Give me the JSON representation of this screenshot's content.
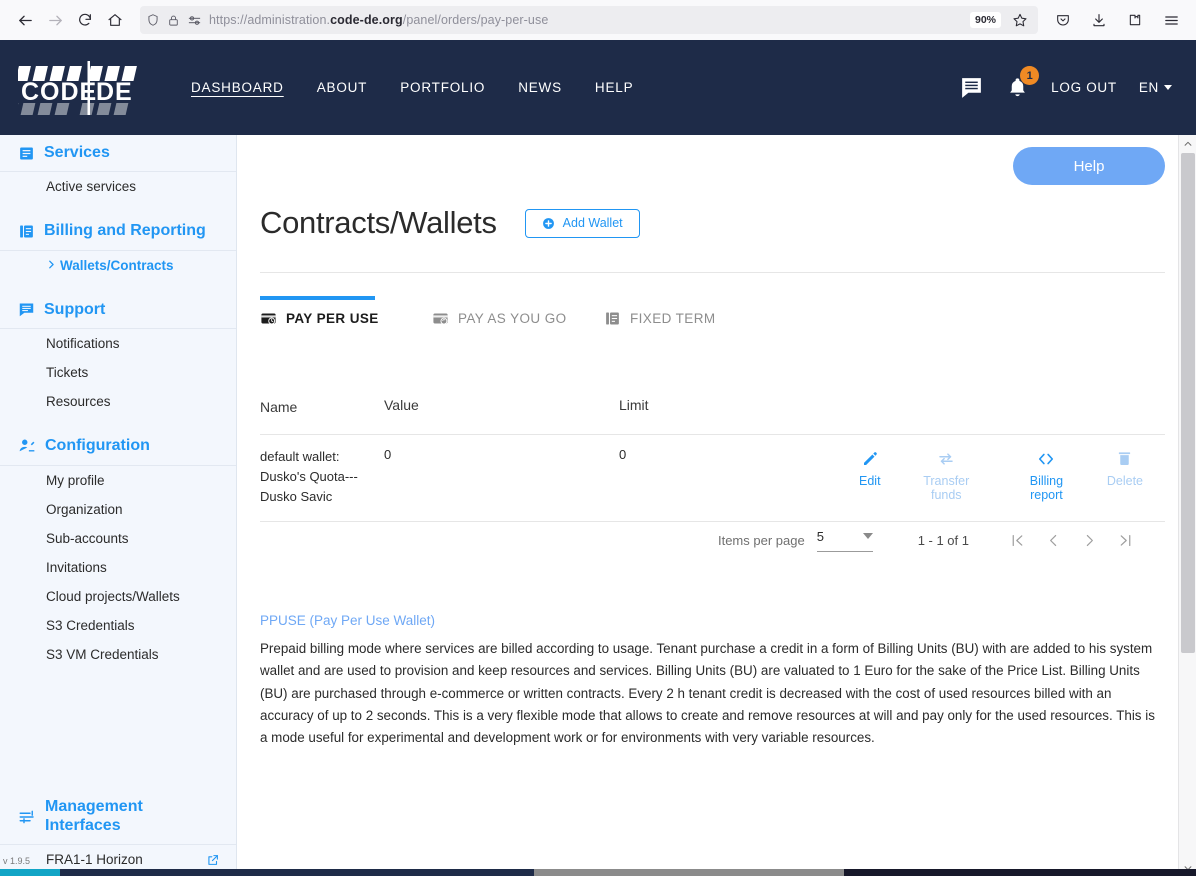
{
  "browser": {
    "back_icon": "back-arrow-icon",
    "forward_icon": "forward-arrow-icon",
    "reload_icon": "reload-icon",
    "home_icon": "home-icon",
    "shield_icon": "shield-icon",
    "lock_icon": "padlock-icon",
    "permissions_icon": "permissions-icon",
    "url_prefix": "https://administration.",
    "url_domain": "code-de.org",
    "url_suffix": "/panel/orders/pay-per-use",
    "zoom_level": "90%",
    "bookmark_icon": "star-icon",
    "pocket_icon": "pocket-icon",
    "downloads_icon": "download-icon",
    "extensions_icon": "extensions-icon",
    "menu_icon": "hamburger-menu-icon"
  },
  "header": {
    "logo_text": "CODE|DE",
    "nav": [
      {
        "label": "DASHBOARD",
        "active": true
      },
      {
        "label": "ABOUT",
        "active": false
      },
      {
        "label": "PORTFOLIO",
        "active": false
      },
      {
        "label": "NEWS",
        "active": false
      },
      {
        "label": "HELP",
        "active": false
      }
    ],
    "messages_icon": "message-icon",
    "notifications_icon": "bell-icon",
    "notification_count": "1",
    "logout_label": "LOG OUT",
    "language": "EN"
  },
  "sidebar": {
    "sections": [
      {
        "title": "Services",
        "icon": "list-box-icon",
        "items": [
          {
            "label": "Active services",
            "active": false
          }
        ]
      },
      {
        "title": "Billing and Reporting",
        "icon": "book-icon",
        "items": [
          {
            "label": "Wallets/Contracts",
            "active": true
          }
        ]
      },
      {
        "title": "Support",
        "icon": "chat-icon",
        "items": [
          {
            "label": "Notifications",
            "active": false
          },
          {
            "label": "Tickets",
            "active": false
          },
          {
            "label": "Resources",
            "active": false
          }
        ]
      },
      {
        "title": "Configuration",
        "icon": "user-settings-icon",
        "items": [
          {
            "label": "My profile",
            "active": false
          },
          {
            "label": "Organization",
            "active": false
          },
          {
            "label": "Sub-accounts",
            "active": false
          },
          {
            "label": "Invitations",
            "active": false
          },
          {
            "label": "Cloud projects/Wallets",
            "active": false
          },
          {
            "label": "S3 Credentials",
            "active": false
          },
          {
            "label": "S3 VM Credentials",
            "active": false
          }
        ]
      }
    ],
    "management": {
      "title": "Management Interfaces",
      "icon": "sliders-icon",
      "items": [
        {
          "label": "FRA1-1 Horizon",
          "external_icon": "external-link-icon"
        }
      ]
    },
    "version": "v 1.9.5"
  },
  "main": {
    "help_label": "Help",
    "page_title": "Contracts/Wallets",
    "add_wallet_label": "Add Wallet",
    "add_wallet_icon": "plus-circle-icon",
    "tabs": [
      {
        "label": "PAY PER USE",
        "icon": "card-clock-icon",
        "active": true
      },
      {
        "label": "PAY AS YOU GO",
        "icon": "card-cycle-icon",
        "active": false
      },
      {
        "label": "FIXED TERM",
        "icon": "document-icon",
        "active": false
      }
    ],
    "table": {
      "columns": [
        "Name",
        "Value",
        "Limit"
      ],
      "rows": [
        {
          "name": "default wallet: Dusko's Quota--- Dusko Savic",
          "name_lines": [
            "default wallet:",
            "Dusko's Quota---",
            "Dusko Savic"
          ],
          "value": "0",
          "limit": "0",
          "actions": [
            {
              "label": "Edit",
              "icon": "pencil-icon",
              "enabled": true
            },
            {
              "label": "Transfer funds",
              "icon": "transfer-arrows-icon",
              "enabled": false
            },
            {
              "label": "Billing report",
              "icon": "code-brackets-icon",
              "enabled": true
            },
            {
              "label": "Delete",
              "icon": "trash-icon",
              "enabled": false
            }
          ]
        }
      ]
    },
    "paginator": {
      "items_per_page_label": "Items per page",
      "items_per_page_value": "5",
      "range_label": "1 - 1 of 1",
      "first_icon": "first-page-icon",
      "prev_icon": "previous-page-icon",
      "next_icon": "next-page-icon",
      "last_icon": "last-page-icon"
    },
    "description": {
      "heading": "PPUSE (Pay Per Use Wallet)",
      "body": "Prepaid billing mode where services are billed according to usage. Tenant purchase a credit in a form of Billing Units (BU) with are added to his system wallet and are used to provision and keep resources and services. Billing Units (BU) are valuated to 1 Euro for the sake of the Price List. Billing Units (BU) are purchased through e-commerce or written contracts. Every 2 h tenant credit is decreased with the cost of used resources billed with an accuracy of up to 2 seconds. This is a very flexible mode that allows to create and remove resources at will and pay only for the used resources. This is a mode useful for experimental and development work or for environments with very variable resources."
    }
  },
  "colors": {
    "brand_navy": "#1e2b48",
    "accent_blue": "#2196f3",
    "help_blue": "#6fa8f5",
    "badge_orange": "#f08a24",
    "sidebar_bg": "#f3f7fd"
  }
}
